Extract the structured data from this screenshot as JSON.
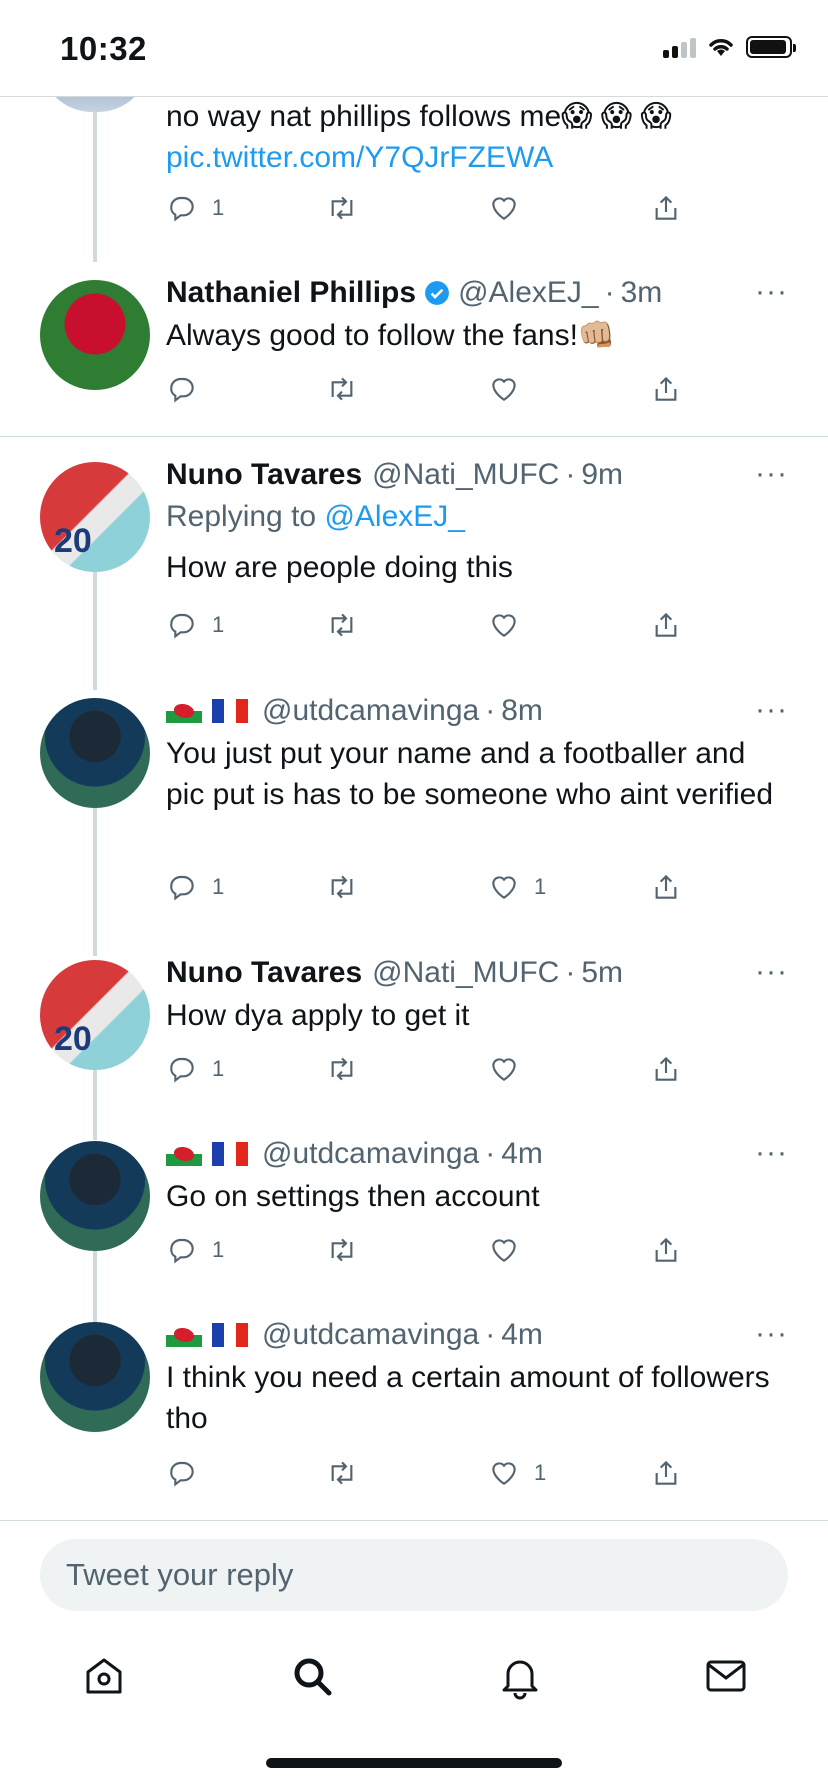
{
  "status": {
    "time": "10:32"
  },
  "tweets": [
    {
      "text": "no way nat phillips follows me😱 😱 😱",
      "link": "pic.twitter.com/Y7QJrFZEWA",
      "reply_count": "1",
      "like_count": ""
    },
    {
      "name": "Nathaniel Phillips",
      "handle": "@AlexEJ_",
      "sep": "·",
      "time": "3m",
      "text": "Always good to follow the fans!👊🏼",
      "reply_count": "",
      "like_count": ""
    },
    {
      "name": "Nuno Tavares",
      "handle": "@Nati_MUFC",
      "sep": "·",
      "time": "9m",
      "replying_label": "Replying to",
      "replying_handle": "@AlexEJ_",
      "text": "How are people doing this",
      "reply_count": "1",
      "like_count": "",
      "avatar_number": "20"
    },
    {
      "handle": "@utdcamavinga",
      "sep": "·",
      "time": "8m",
      "text": "You just put your name and a footballer and pic put is has to be someone who aint verified",
      "reply_count": "1",
      "like_count": "1"
    },
    {
      "name": "Nuno Tavares",
      "handle": "@Nati_MUFC",
      "sep": "·",
      "time": "5m",
      "text": "How dya apply to get it",
      "reply_count": "1",
      "like_count": "",
      "avatar_number": "20"
    },
    {
      "handle": "@utdcamavinga",
      "sep": "·",
      "time": "4m",
      "text": "Go on settings then account",
      "reply_count": "1",
      "like_count": ""
    },
    {
      "handle": "@utdcamavinga",
      "sep": "·",
      "time": "4m",
      "text": "I think you need a certain amount of followers tho",
      "reply_count": "",
      "like_count": "1"
    }
  ],
  "more_glyph": "···",
  "compose": {
    "placeholder": "Tweet your reply"
  },
  "tabs": [
    "home-icon",
    "search-icon",
    "notifications-icon",
    "messages-icon"
  ],
  "colors": {
    "accent": "#1d9bf0",
    "muted": "#536471",
    "divider": "#cfd9de"
  }
}
